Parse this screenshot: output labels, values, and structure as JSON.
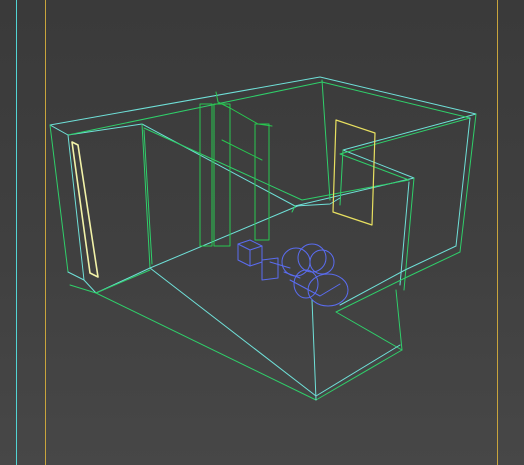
{
  "viewport": {
    "kind": "3d-wireframe-perspective-view",
    "background": "#404040"
  },
  "colors": {
    "frame_guide_gold": "#c8a43c",
    "frame_guide_cyan": "#52d4d4",
    "wall_cyan": "#6fe0d8",
    "wall_green": "#2fcf6a",
    "door_frame_green": "#28c850",
    "selected_yellow": "#e8e060",
    "selected_pale_yellow": "#f2f2a8",
    "helper_blue": "#5a6cf0"
  },
  "objects": [
    {
      "name": "room-shell",
      "kind": "walls"
    },
    {
      "name": "door-frame",
      "kind": "frame"
    },
    {
      "name": "window-panel-right",
      "kind": "panel"
    },
    {
      "name": "window-panel-left",
      "kind": "panel"
    },
    {
      "name": "light-helper",
      "kind": "helper"
    }
  ]
}
